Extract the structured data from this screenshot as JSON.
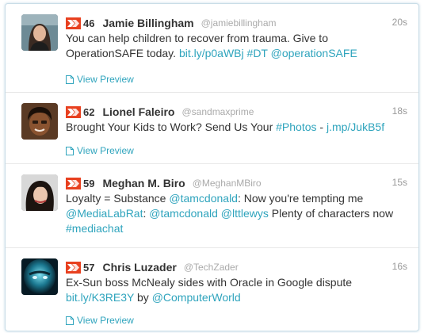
{
  "preview_label": "View Preview",
  "colors": {
    "accent": "#2fa4bd",
    "klout": "#e8401f",
    "text": "#333333",
    "muted": "#aaaaaa"
  },
  "icons": {
    "klout": "klout-icon",
    "preview": "document-icon"
  },
  "tweets": [
    {
      "score": "46",
      "name": "Jamie Billingham",
      "handle": "@jamiebillingham",
      "time": "20s",
      "lines": [
        [
          {
            "t": "You can help children to recover from trauma. Give to"
          }
        ],
        [
          {
            "t": "OperationSAFE today. "
          },
          {
            "t": "bit.ly/p0aWBj",
            "link": true
          },
          {
            "t": " "
          },
          {
            "t": "#DT",
            "link": true
          },
          {
            "t": " "
          },
          {
            "t": "@operationSAFE",
            "link": true
          }
        ]
      ]
    },
    {
      "score": "62",
      "name": "Lionel Faleiro",
      "handle": "@sandmaxprime",
      "time": "18s",
      "lines": [
        [
          {
            "t": "Brought Your Kids to Work? Send Us Your "
          },
          {
            "t": "#Photos",
            "link": true
          },
          {
            "t": " - "
          },
          {
            "t": "j.mp/JukB5f",
            "link": true
          }
        ]
      ]
    },
    {
      "score": "59",
      "name": "Meghan M. Biro",
      "handle": "@MeghanMBiro",
      "time": "15s",
      "lines": [
        [
          {
            "t": "Loyalty = Substance "
          },
          {
            "t": "@tamcdonald",
            "link": true
          },
          {
            "t": ": Now you're tempting me"
          }
        ],
        [
          {
            "t": "@MediaLabRat",
            "link": true
          },
          {
            "t": ": "
          },
          {
            "t": "@tamcdonald",
            "link": true
          },
          {
            "t": " "
          },
          {
            "t": "@lttlewys",
            "link": true
          },
          {
            "t": " Plenty of characters now"
          }
        ],
        [
          {
            "t": "#mediachat",
            "link": true
          }
        ]
      ]
    },
    {
      "score": "57",
      "name": "Chris Luzader",
      "handle": "@TechZader",
      "time": "16s",
      "lines": [
        [
          {
            "t": "Ex-Sun boss McNealy sides with Oracle in Google dispute"
          }
        ],
        [
          {
            "t": "bit.ly/K3RE3Y",
            "link": true
          },
          {
            "t": " by "
          },
          {
            "t": "@ComputerWorld",
            "link": true
          }
        ]
      ]
    }
  ]
}
